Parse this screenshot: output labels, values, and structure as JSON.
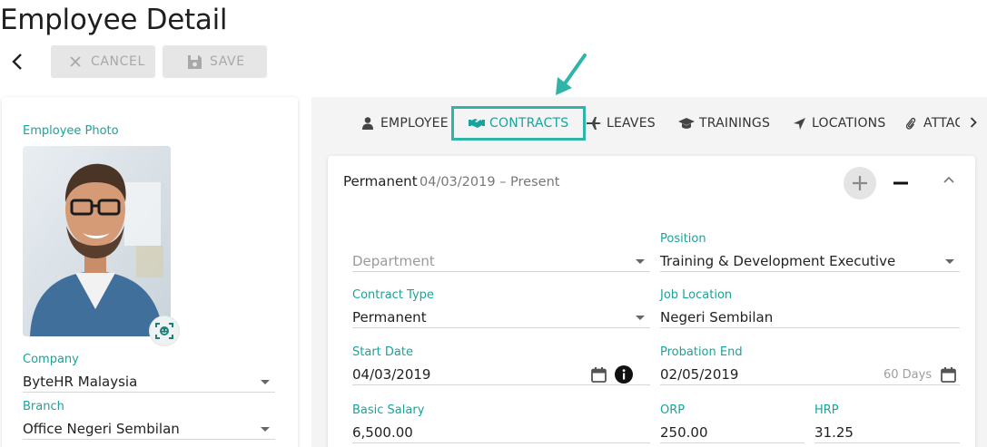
{
  "page": {
    "title": "Employee Detail"
  },
  "toolbar": {
    "cancel_label": "CANCEL",
    "save_label": "SAVE"
  },
  "tabs": [
    {
      "label": "EMPLOYEE",
      "icon": "person-icon"
    },
    {
      "label": "CONTRACTS",
      "icon": "handshake-icon",
      "active": true
    },
    {
      "label": "LEAVES",
      "icon": "plane-icon"
    },
    {
      "label": "TRAININGS",
      "icon": "graduation-cap-icon"
    },
    {
      "label": "LOCATIONS",
      "icon": "location-arrow-icon"
    },
    {
      "label": "ATTACH",
      "icon": "paperclip-icon"
    }
  ],
  "left": {
    "photo_label": "Employee Photo",
    "company": {
      "label": "Company",
      "value": "ByteHR Malaysia"
    },
    "branch": {
      "label": "Branch",
      "value": "Office Negeri Sembilan"
    }
  },
  "contract": {
    "type": "Permanent",
    "period": "04/03/2019 – Present",
    "department": {
      "placeholder": "Department"
    },
    "position": {
      "label": "Position",
      "value": "Training & Development Executive"
    },
    "contract_type": {
      "label": "Contract Type",
      "value": "Permanent"
    },
    "job_location": {
      "label": "Job Location",
      "value": "Negeri Sembilan"
    },
    "start_date": {
      "label": "Start Date",
      "value": "04/03/2019"
    },
    "probation_end": {
      "label": "Probation End",
      "value": "02/05/2019",
      "suffix": "60 Days"
    },
    "basic_salary": {
      "label": "Basic Salary",
      "value": "6,500.00"
    },
    "orp": {
      "label": "ORP",
      "value": "250.00"
    },
    "hrp": {
      "label": "HRP",
      "value": "31.25"
    }
  },
  "colors": {
    "accent": "#1aa39a",
    "highlight": "#2fb4a8"
  }
}
